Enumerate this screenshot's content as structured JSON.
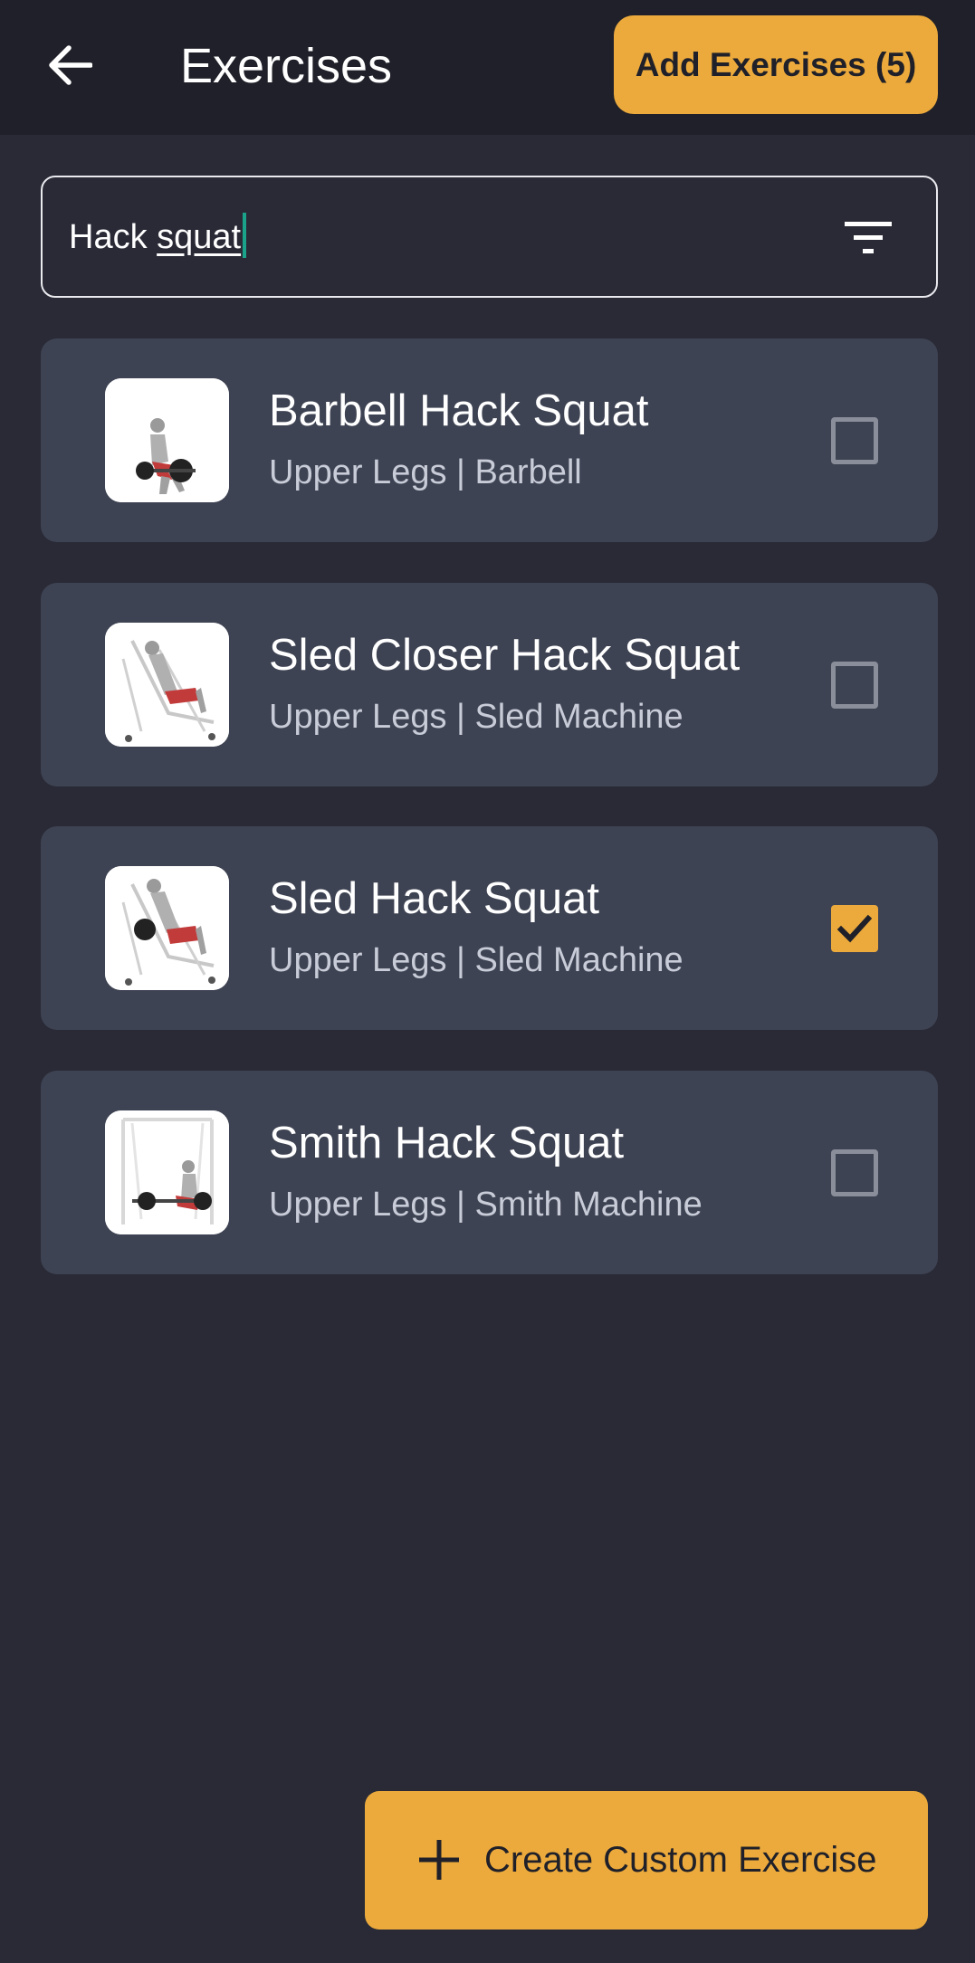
{
  "header": {
    "title": "Exercises",
    "add_button_label": "Add Exercises (5)",
    "back_icon": "arrow-left-icon"
  },
  "search": {
    "value_plain": "Hack ",
    "value_underlined": "squat",
    "filter_icon": "filter-icon"
  },
  "exercises": [
    {
      "name": "Barbell Hack Squat",
      "meta": "Upper Legs | Barbell",
      "checked": false
    },
    {
      "name": "Sled Closer Hack Squat",
      "meta": "Upper Legs | Sled Machine",
      "checked": false
    },
    {
      "name": "Sled Hack Squat",
      "meta": "Upper Legs | Sled Machine",
      "checked": true
    },
    {
      "name": "Smith Hack Squat",
      "meta": "Upper Legs | Smith Machine",
      "checked": false
    }
  ],
  "fab": {
    "label": "Create Custom Exercise",
    "icon": "plus-icon"
  },
  "colors": {
    "accent": "#ecaa3c",
    "background": "#292a36",
    "header": "#1f2029",
    "card": "#3e4353",
    "caret": "#1aa38a"
  }
}
